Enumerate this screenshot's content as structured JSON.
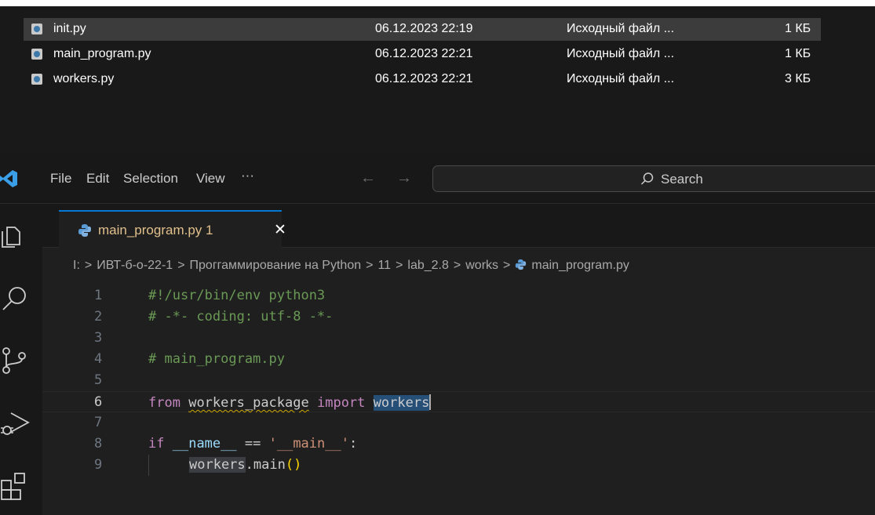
{
  "explorer": {
    "files": [
      {
        "name": "init.py",
        "date": "06.12.2023 22:19",
        "type": "Исходный файл ...",
        "size": "1 КБ",
        "selected": true
      },
      {
        "name": "main_program.py",
        "date": "06.12.2023 22:21",
        "type": "Исходный файл ...",
        "size": "1 КБ",
        "selected": false
      },
      {
        "name": "workers.py",
        "date": "06.12.2023 22:21",
        "type": "Исходный файл ...",
        "size": "3 КБ",
        "selected": false
      }
    ]
  },
  "titlebar": {
    "menu": [
      "File",
      "Edit",
      "Selection",
      "View",
      "···"
    ],
    "back": "←",
    "forward": "→",
    "search_placeholder": "Search"
  },
  "activity_icons": [
    "explorer-icon",
    "search-icon",
    "source-control-icon",
    "run-debug-icon",
    "extensions-icon"
  ],
  "editor": {
    "tab": {
      "label": "main_program.py 1",
      "close": "✕"
    },
    "breadcrumb": [
      "I:",
      "ИВТ-б-о-22-1",
      "Проггаммирование на Python",
      "11",
      "lab_2.8",
      "works",
      "main_program.py"
    ],
    "breadcrumb_sep": ">",
    "lines": [
      {
        "num": "1",
        "text": "#!/usr/bin/env python3"
      },
      {
        "num": "2",
        "text": "# -*- coding: utf-8 -*-"
      },
      {
        "num": "3",
        "text": ""
      },
      {
        "num": "4",
        "text": "# main_program.py"
      },
      {
        "num": "5",
        "text": ""
      },
      {
        "num": "6",
        "tokens": [
          "from",
          "workers_package",
          "import",
          "workers"
        ]
      },
      {
        "num": "7",
        "text": ""
      },
      {
        "num": "8",
        "tokens": [
          "if",
          "__name__",
          "==",
          "'__main__'",
          ":"
        ]
      },
      {
        "num": "9",
        "tokens": [
          "workers",
          ".main",
          "()"
        ]
      }
    ]
  },
  "colors": {
    "accent": "#0078d4",
    "keyword": "#c586c0",
    "comment": "#6a9955",
    "string": "#ce9178",
    "variable": "#9cdcfe",
    "warning": "#cca700",
    "tab_label": "#e2c08d"
  }
}
